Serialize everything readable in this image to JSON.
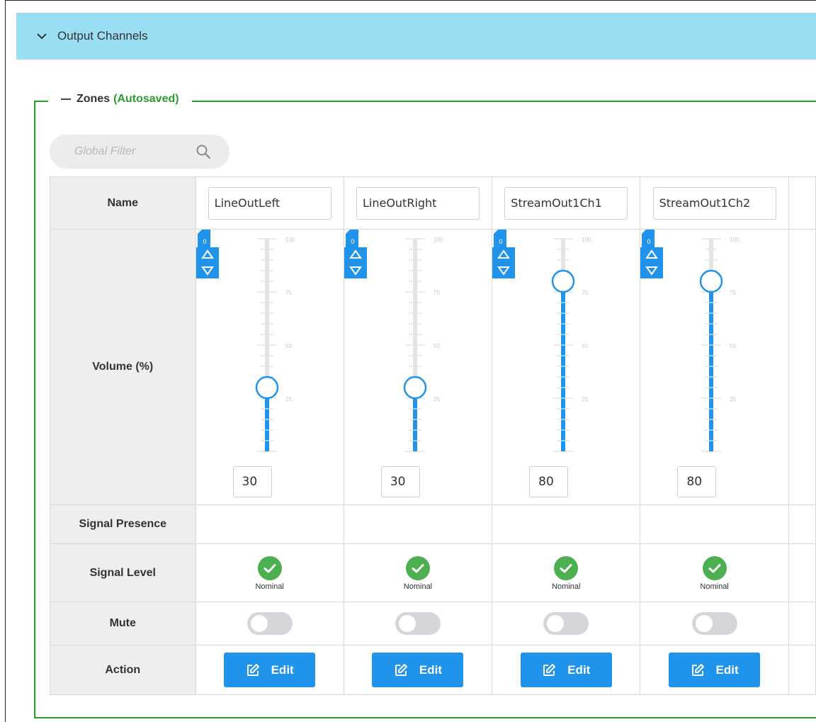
{
  "panel": {
    "title": "Output Channels",
    "icon": "chevron-down-icon"
  },
  "zones": {
    "title": "Zones",
    "status": "(Autosaved)",
    "filter_placeholder": "Global Filter",
    "row_labels": {
      "name": "Name",
      "volume": "Volume (%)",
      "signal_presence": "Signal Presence",
      "signal_level": "Signal Level",
      "mute": "Mute",
      "action": "Action"
    },
    "scale_labels": [
      "100",
      "75",
      "50",
      "25"
    ],
    "channels": [
      {
        "name": "LineOutLeft",
        "volume": "30",
        "volume_fraction": 0.3,
        "offset": "0",
        "signal_level": "Nominal",
        "mute": false,
        "action": "Edit"
      },
      {
        "name": "LineOutRight",
        "volume": "30",
        "volume_fraction": 0.3,
        "offset": "0",
        "signal_level": "Nominal",
        "mute": false,
        "action": "Edit"
      },
      {
        "name": "StreamOut1Ch1",
        "volume": "80",
        "volume_fraction": 0.8,
        "offset": "0",
        "signal_level": "Nominal",
        "mute": false,
        "action": "Edit"
      },
      {
        "name": "StreamOut1Ch2",
        "volume": "80",
        "volume_fraction": 0.8,
        "offset": "0",
        "signal_level": "Nominal",
        "mute": false,
        "action": "Edit"
      }
    ]
  },
  "colors": {
    "header_bg": "#9adef4",
    "accent_green": "#2e9b2e",
    "slider_blue": "#1f94ea",
    "status_green": "#4caf50",
    "button_blue": "#1f94ea"
  }
}
